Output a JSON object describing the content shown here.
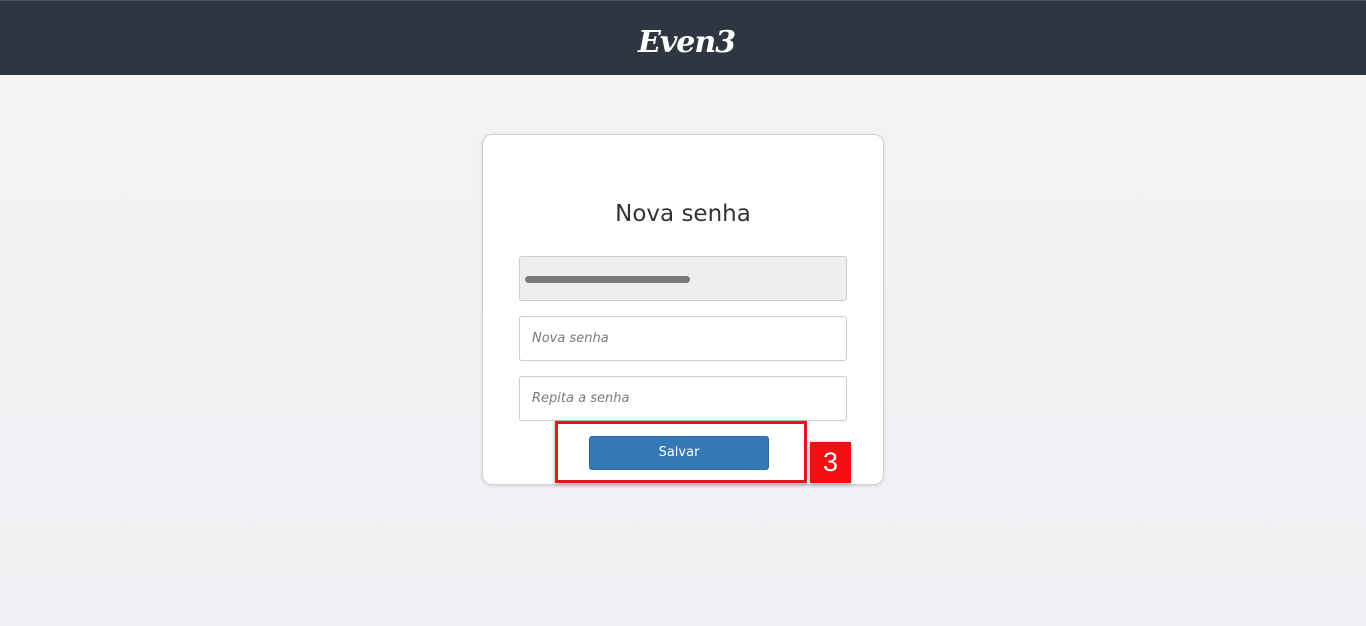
{
  "header": {
    "logo_text": "Even3"
  },
  "form": {
    "title": "Nova senha",
    "email": {
      "value": "",
      "redacted": true
    },
    "new_password": {
      "placeholder": "Nova senha",
      "value": ""
    },
    "repeat_password": {
      "placeholder": "Repita a senha",
      "value": ""
    },
    "save_label": "Salvar"
  },
  "annotation": {
    "step_number": "3"
  },
  "colors": {
    "header_bg": "#2d3641",
    "button_bg": "#3478b6",
    "annotation_red": "#e0191b"
  }
}
